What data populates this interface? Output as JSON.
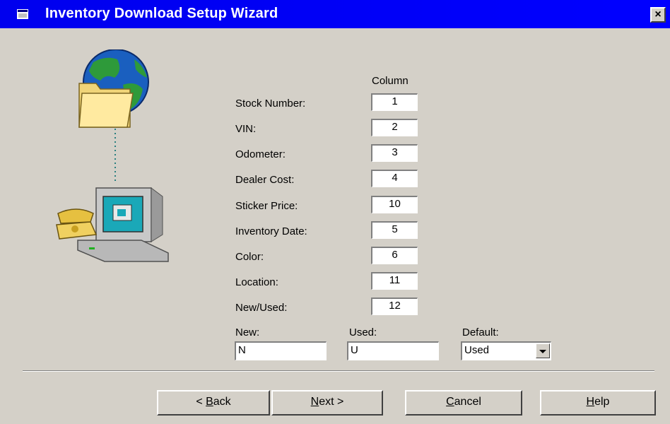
{
  "window": {
    "title": "Inventory Download Setup Wizard",
    "close_label": "×"
  },
  "columns": {
    "header": "Column",
    "rows": [
      {
        "label": "Stock Number:",
        "value": "1"
      },
      {
        "label": "VIN:",
        "value": "2"
      },
      {
        "label": "Odometer:",
        "value": "3"
      },
      {
        "label": "Dealer Cost:",
        "value": "4"
      },
      {
        "label": "Sticker Price:",
        "value": "10"
      },
      {
        "label": "Inventory Date:",
        "value": "5"
      },
      {
        "label": "Color:",
        "value": "6"
      },
      {
        "label": "Location:",
        "value": "11"
      },
      {
        "label": "New/Used:",
        "value": "12"
      }
    ]
  },
  "new_used": {
    "new_label": "New:",
    "new_value": "N",
    "used_label": "Used:",
    "used_value": "U",
    "default_label": "Default:",
    "default_value": "Used"
  },
  "buttons": {
    "back_pre": "< ",
    "back_key": "B",
    "back_post": "ack",
    "next_key": "N",
    "next_post": "ext >",
    "cancel_key": "C",
    "cancel_post": "ancel",
    "help_key": "H",
    "help_post": "elp"
  },
  "icons": {
    "illustration": "globe-folder-computer-phone-icon",
    "title": "app-window-icon"
  }
}
